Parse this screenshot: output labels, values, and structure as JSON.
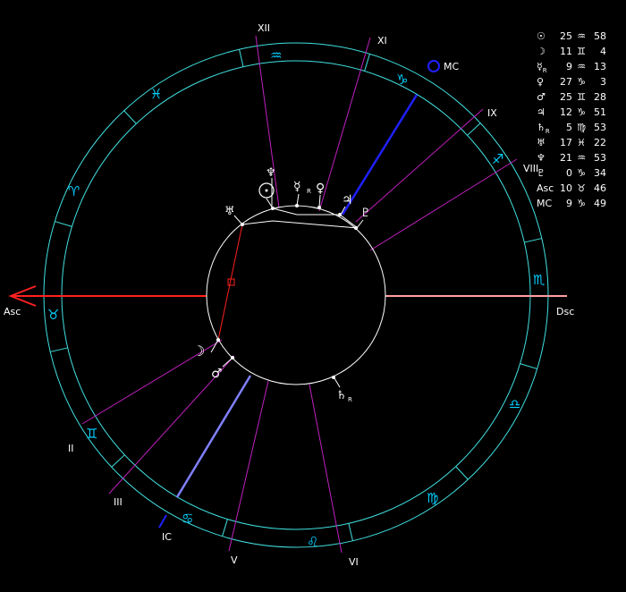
{
  "houses": [
    "XII",
    "XI",
    "IX",
    "VIII",
    "II",
    "III",
    "IC",
    "V",
    "VI"
  ],
  "angles": {
    "asc": "Asc",
    "dsc": "Dsc",
    "mc": "MC",
    "ic": "IC"
  },
  "zodiac_glyphs": {
    "aquarius": "♒",
    "pisces": "♓",
    "aries": "♈",
    "taurus": "♉",
    "gemini": "♊",
    "cancer": "♋",
    "leo": "♌",
    "virgo": "♍",
    "libra": "♎",
    "scorpio": "♏",
    "sagittarius": "♐",
    "capricorn": "♑"
  },
  "planet_glyphs": {
    "sun": "☉",
    "moon": "☽",
    "mercury": "☿",
    "venus": "♀",
    "mars": "♂",
    "jupiter": "♃",
    "saturn": "♄",
    "uranus": "♅",
    "neptune": "♆",
    "pluto": "♇",
    "retro": "R"
  },
  "positions": [
    {
      "symbol": "☉",
      "retro": "",
      "deg": "25",
      "sign": "♒",
      "min": "58"
    },
    {
      "symbol": "☽",
      "retro": "",
      "deg": "11",
      "sign": "♊",
      "min": "4"
    },
    {
      "symbol": "☿",
      "retro": "R",
      "deg": "9",
      "sign": "♒",
      "min": "13"
    },
    {
      "symbol": "♀",
      "retro": "",
      "deg": "27",
      "sign": "♑",
      "min": "3"
    },
    {
      "symbol": "♂",
      "retro": "",
      "deg": "25",
      "sign": "♊",
      "min": "28"
    },
    {
      "symbol": "♃",
      "retro": "",
      "deg": "12",
      "sign": "♑",
      "min": "51"
    },
    {
      "symbol": "♄",
      "retro": "R",
      "deg": "5",
      "sign": "♍",
      "min": "53"
    },
    {
      "symbol": "♅",
      "retro": "",
      "deg": "17",
      "sign": "♓",
      "min": "22"
    },
    {
      "symbol": "♆",
      "retro": "",
      "deg": "21",
      "sign": "♒",
      "min": "53"
    },
    {
      "symbol": "♇",
      "retro": "",
      "deg": "0",
      "sign": "♑",
      "min": "34"
    },
    {
      "symbol": "Asc",
      "retro": "",
      "deg": "10",
      "sign": "♉",
      "min": "46"
    },
    {
      "symbol": "MC",
      "retro": "",
      "deg": "9",
      "sign": "♑",
      "min": "49"
    }
  ],
  "colors": {
    "ring": "#40e0e0",
    "house_line": "#c020c0",
    "asc_axis": "#ff2020",
    "dsc_axis": "#ffa0a0",
    "mc_axis": "#2020ff",
    "ic_axis": "#8080ff",
    "aspect_red": "#ff2020",
    "zodiac": "#00d0ff"
  }
}
